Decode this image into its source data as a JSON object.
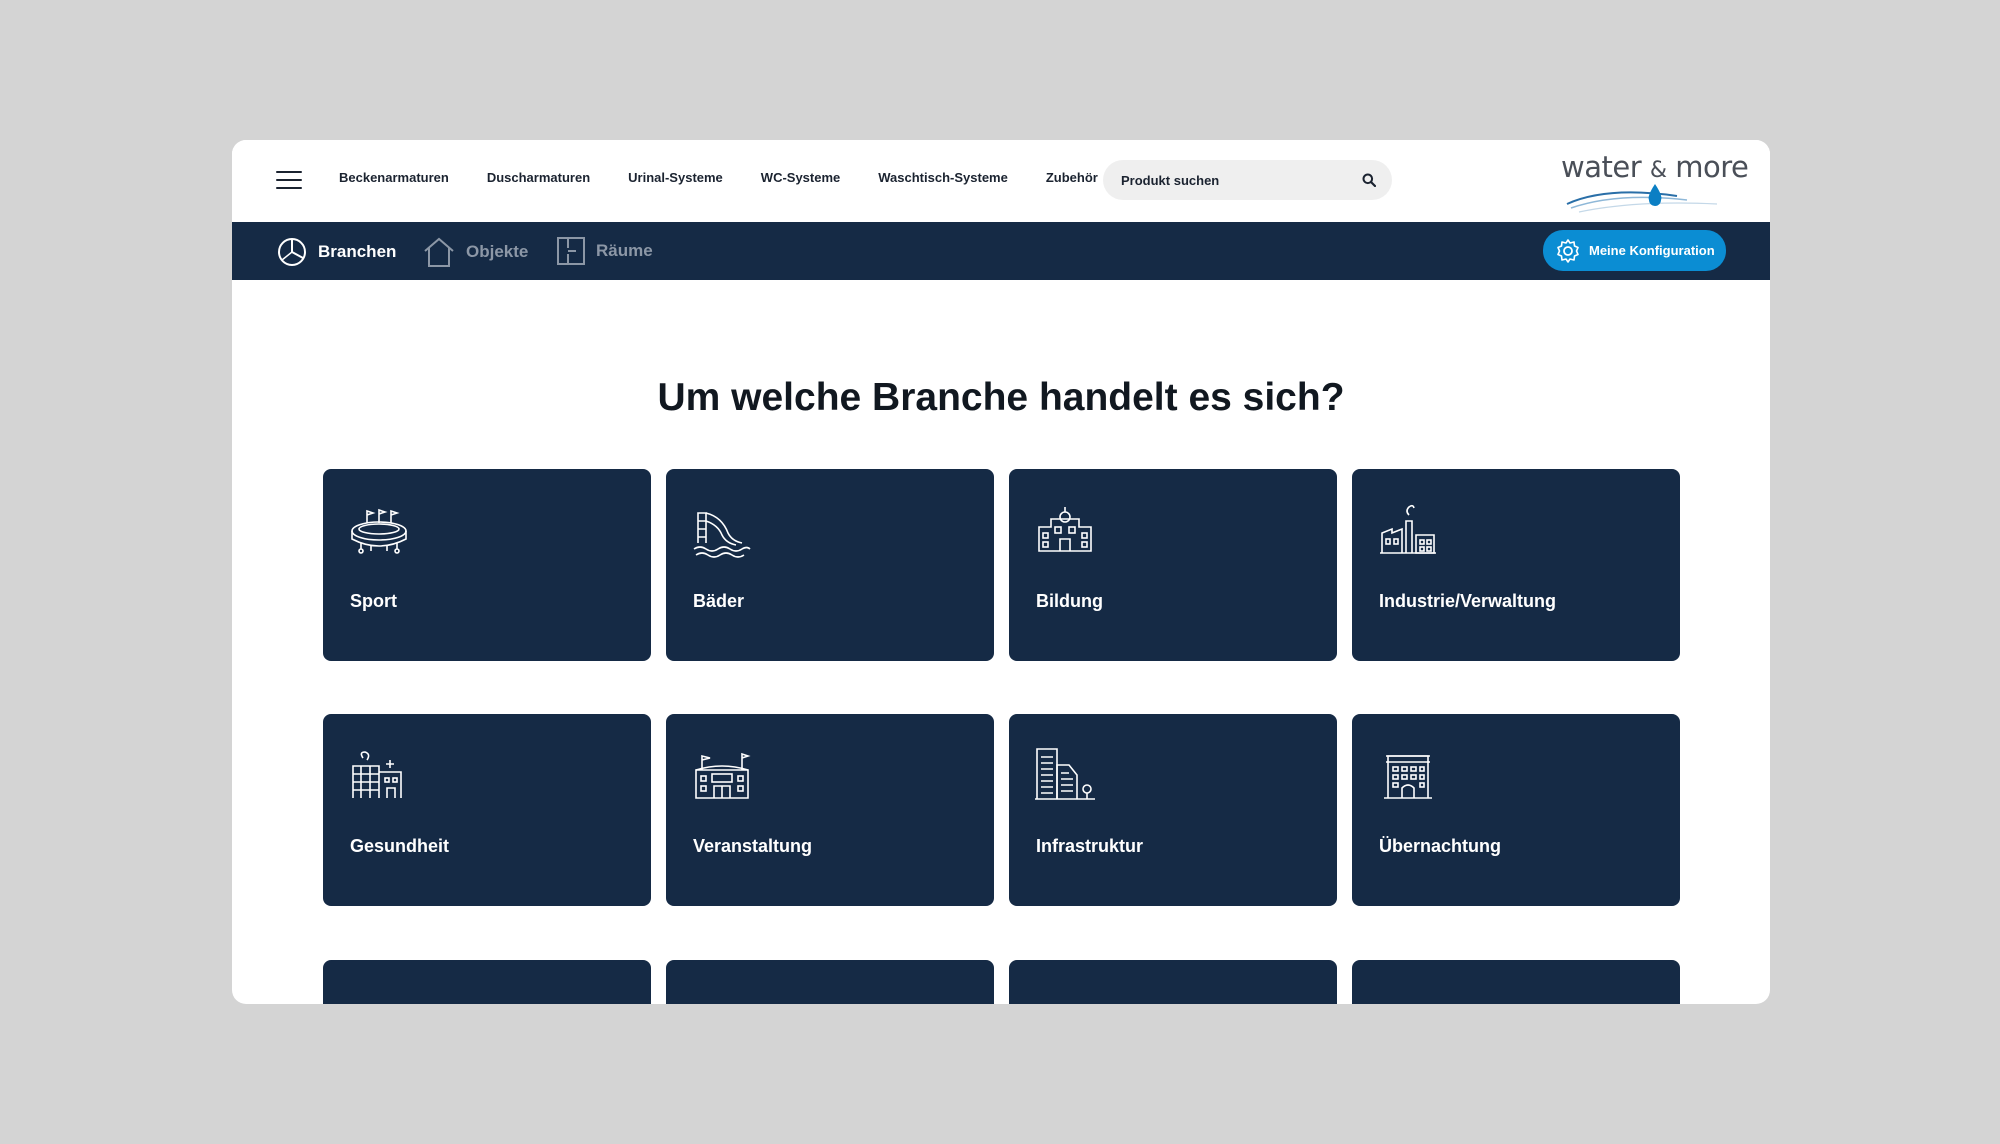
{
  "nav": {
    "links": [
      "Beckenarmaturen",
      "Duscharmaturen",
      "Urinal-Systeme",
      "WC-Systeme",
      "Waschtisch-Systeme",
      "Zubehör"
    ],
    "search_placeholder": "Produkt suchen"
  },
  "logo": {
    "text_left": "water",
    "text_amp": "&",
    "text_right": "more"
  },
  "subnav": {
    "items": [
      {
        "label": "Branchen",
        "icon": "pie-chart-icon",
        "active": true
      },
      {
        "label": "Objekte",
        "icon": "house-icon",
        "active": false
      },
      {
        "label": "Räume",
        "icon": "floorplan-icon",
        "active": false
      }
    ],
    "config_label": "Meine Konfiguration"
  },
  "main": {
    "heading": "Um welche Branche handelt es sich?",
    "cards": [
      {
        "label": "Sport",
        "icon": "stadium-icon"
      },
      {
        "label": "Bäder",
        "icon": "waterslide-icon"
      },
      {
        "label": "Bildung",
        "icon": "school-icon"
      },
      {
        "label": "Industrie/Verwaltung",
        "icon": "factory-icon"
      },
      {
        "label": "Gesundheit",
        "icon": "hospital-icon"
      },
      {
        "label": "Veranstaltung",
        "icon": "event-hall-icon"
      },
      {
        "label": "Infrastruktur",
        "icon": "skyscraper-icon"
      },
      {
        "label": "Übernachtung",
        "icon": "hotel-icon"
      }
    ]
  },
  "colors": {
    "navy": "#152a45",
    "accent": "#0b8dd3",
    "background": "#d4d4d4"
  }
}
